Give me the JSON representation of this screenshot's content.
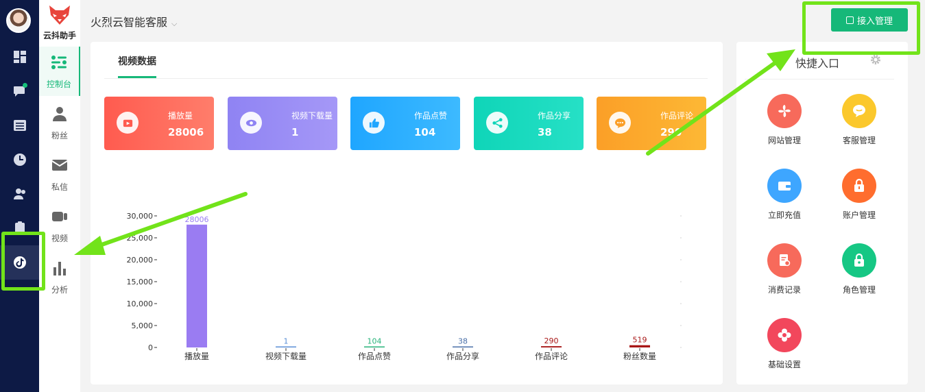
{
  "app": {
    "title": "火烈云智能客服",
    "brand": "云抖助手"
  },
  "header": {
    "access_button": "接入管理"
  },
  "subnav": [
    {
      "label": "控制台"
    },
    {
      "label": "粉丝"
    },
    {
      "label": "私信"
    },
    {
      "label": "视频"
    },
    {
      "label": "分析"
    }
  ],
  "main": {
    "tab": "视频数据",
    "cards": [
      {
        "label": "播放量",
        "value": "28006",
        "color": "#ff6a5b"
      },
      {
        "label": "视频下载量",
        "value": "1",
        "color": "#9c8cf5"
      },
      {
        "label": "作品点赞",
        "value": "104",
        "color": "#2aaeff"
      },
      {
        "label": "作品分享",
        "value": "38",
        "color": "#16d8bd"
      },
      {
        "label": "作品评论",
        "value": "290",
        "color": "#fcab2b"
      }
    ]
  },
  "chart_data": {
    "type": "bar",
    "categories": [
      "播放量",
      "视频下载量",
      "作品点赞",
      "作品分享",
      "作品评论",
      "粉丝数量"
    ],
    "values": [
      28006,
      1,
      104,
      38,
      290,
      519
    ],
    "label_colors": [
      "#9a7cf2",
      "#5b8fd6",
      "#28b37a",
      "#4a6fa8",
      "#a81717",
      "#a81717"
    ],
    "bar_colors": [
      "#9a7cf2",
      "#5b8fd6",
      "#28b37a",
      "#4a6fa8",
      "#a81717",
      "#a81717"
    ],
    "yticks": [
      "30,000",
      "25,000",
      "20,000",
      "15,000",
      "10,000",
      "5,000",
      "0"
    ],
    "ylim": [
      0,
      30000
    ]
  },
  "quick": {
    "title": "快捷入口",
    "items": [
      {
        "label": "网站管理",
        "color": "#f76a5b"
      },
      {
        "label": "客服管理",
        "color": "#fbc82c"
      },
      {
        "label": "立即充值",
        "color": "#3ea6ff"
      },
      {
        "label": "账户管理",
        "color": "#ff6d2e"
      },
      {
        "label": "消费记录",
        "color": "#f76a5b"
      },
      {
        "label": "角色管理",
        "color": "#16c784"
      },
      {
        "label": "基础设置",
        "color": "#f2475c"
      }
    ]
  },
  "colors": {
    "accent": "#16b879",
    "rail": "#0d1a45",
    "highlight": "#72e31a"
  }
}
